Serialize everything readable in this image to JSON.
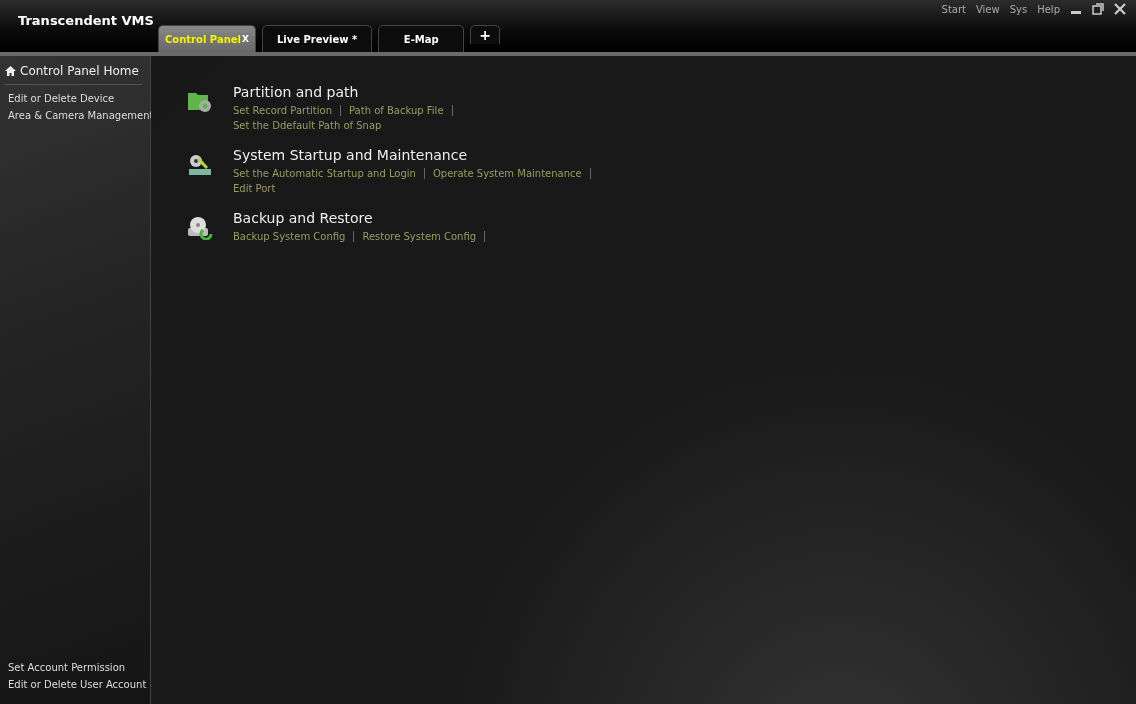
{
  "app": {
    "title": "Transcendent VMS"
  },
  "tabs": [
    {
      "label": "Control Panel",
      "selected": true,
      "close": "X"
    },
    {
      "label": "Live Preview *",
      "selected": false
    },
    {
      "label": "E-Map",
      "selected": false
    }
  ],
  "add_tab": "+",
  "menu": [
    "Start",
    "View",
    "Sys",
    "Help"
  ],
  "sidebar": {
    "home": "Control Panel Home",
    "items": [
      "Edit or Delete Device",
      "Area & Camera Management"
    ],
    "bottom_items": [
      "Set Account Permission",
      "Edit or Delete User Account"
    ]
  },
  "sections": [
    {
      "kind": "folder",
      "title": "Partition and path",
      "links": [
        [
          "Set Record Partition",
          "Path of Backup File"
        ],
        [
          "Set the Ddefault Path of Snap"
        ]
      ]
    },
    {
      "kind": "maintenance",
      "title": "System Startup and Maintenance",
      "links": [
        [
          "Set the Automatic Startup and Login",
          "Operate System Maintenance"
        ],
        [
          "Edit Port"
        ]
      ]
    },
    {
      "kind": "backup",
      "title": "Backup and Restore",
      "links": [
        [
          "Backup System Config",
          "Restore System Config"
        ]
      ]
    }
  ]
}
